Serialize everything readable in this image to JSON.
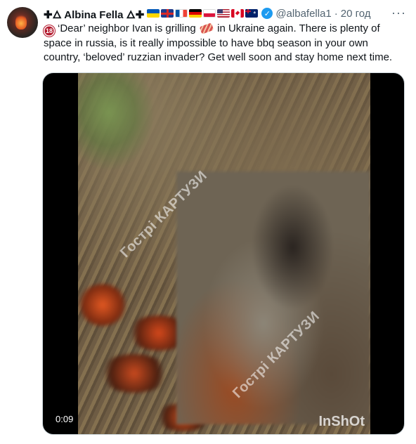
{
  "author": {
    "name": "✚🜂 Albina Fella 🜂✚",
    "flags": [
      "ua",
      "gb",
      "fr",
      "de",
      "pl",
      "us",
      "ca",
      "au"
    ],
    "handle": "@albafella1",
    "separator": "·",
    "time": "20 год"
  },
  "tweet": {
    "badge": "18",
    "text_part1": "‘Dear’ neighbor Ivan is grilling",
    "text_part2": "in Ukraine again. There is plenty of space in russia, is it really impossible to have bbq season in your own country, ‘beloved’ ruzzian invader? Get well soon and stay home next time."
  },
  "media": {
    "duration": "0:09",
    "watermark": "Гострі КАРТУЗИ",
    "app_watermark": "InShOt"
  },
  "icons": {
    "more": "more-icon",
    "verified": "verified-icon",
    "adult": "18-plus-icon",
    "bacon": "bacon-icon"
  },
  "colors": {
    "verified": "#1d9bf0",
    "secondary_text": "#536471"
  }
}
